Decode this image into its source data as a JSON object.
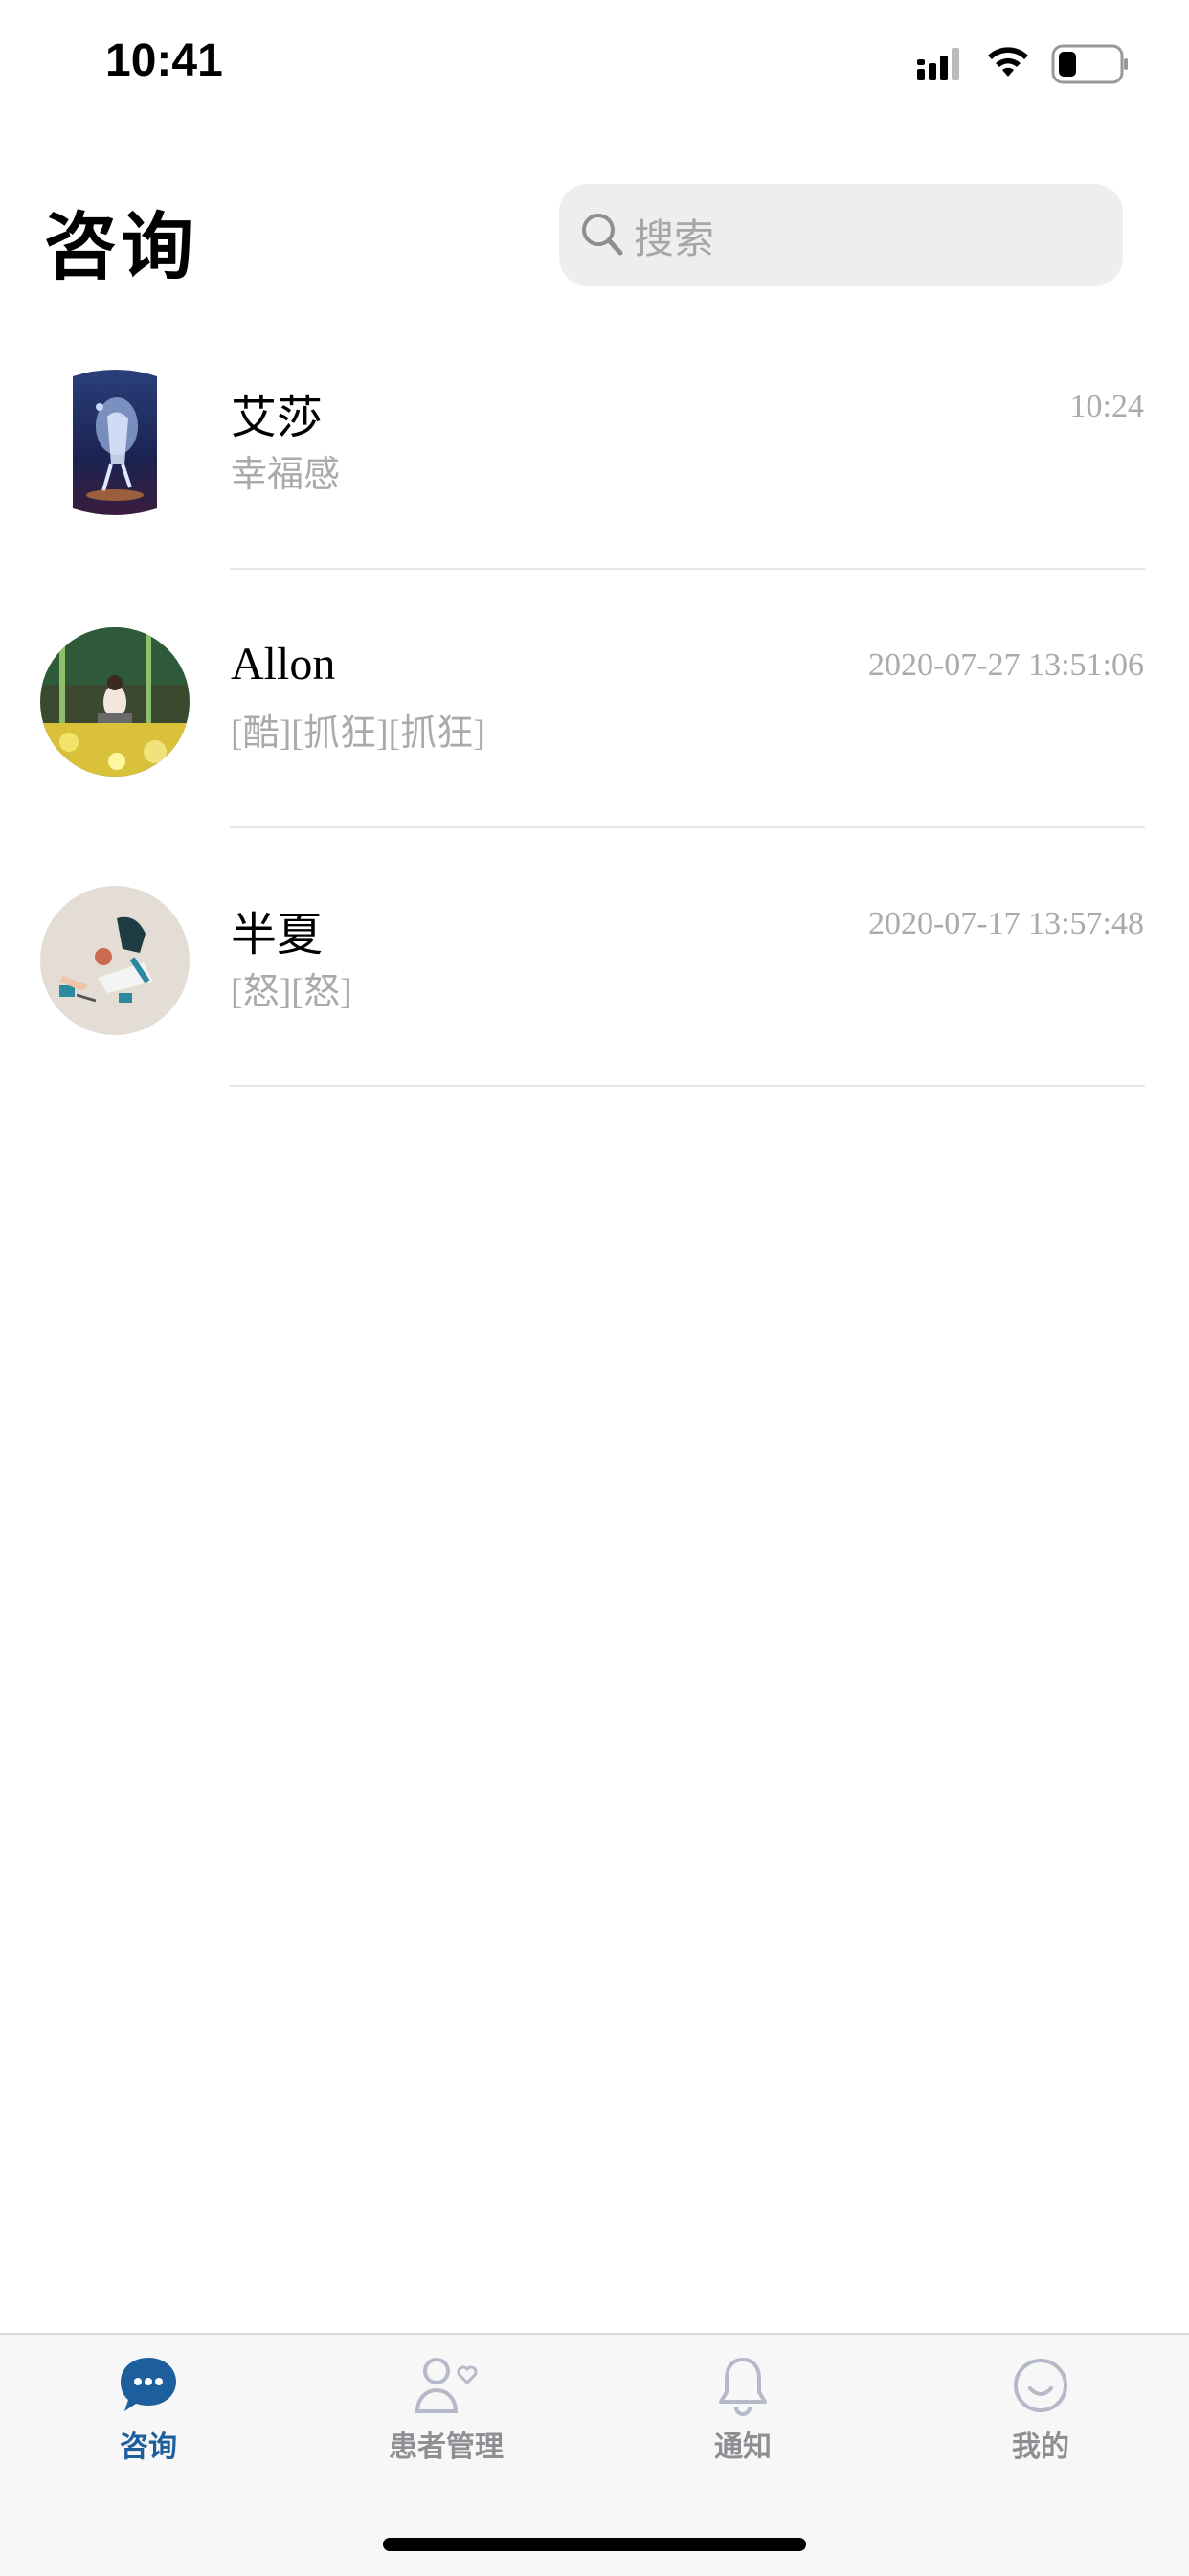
{
  "status_bar": {
    "time": "10:41"
  },
  "header": {
    "title": "咨询"
  },
  "search": {
    "placeholder": "搜索"
  },
  "conversations": [
    {
      "name": "艾莎",
      "time": "10:24",
      "preview": "幸福感",
      "avatar": "character-portrait-avatar"
    },
    {
      "name": "Allon",
      "time": "2020-07-27 13:51:06",
      "preview": "[酷][抓狂][抓狂]",
      "avatar": "photo-avatar"
    },
    {
      "name": "半夏",
      "time": "2020-07-17 13:57:48",
      "preview": "[怒][怒]",
      "avatar": "illustration-avatar"
    }
  ],
  "tabs": [
    {
      "label": "咨询",
      "icon": "chat-bubble-icon",
      "active": true
    },
    {
      "label": "患者管理",
      "icon": "patient-heart-icon",
      "active": false
    },
    {
      "label": "通知",
      "icon": "bell-icon",
      "active": false
    },
    {
      "label": "我的",
      "icon": "smile-icon",
      "active": false
    }
  ],
  "colors": {
    "accent": "#1d5f9c",
    "inactive": "#8e8e93",
    "muted_text": "#aaaaaa"
  }
}
